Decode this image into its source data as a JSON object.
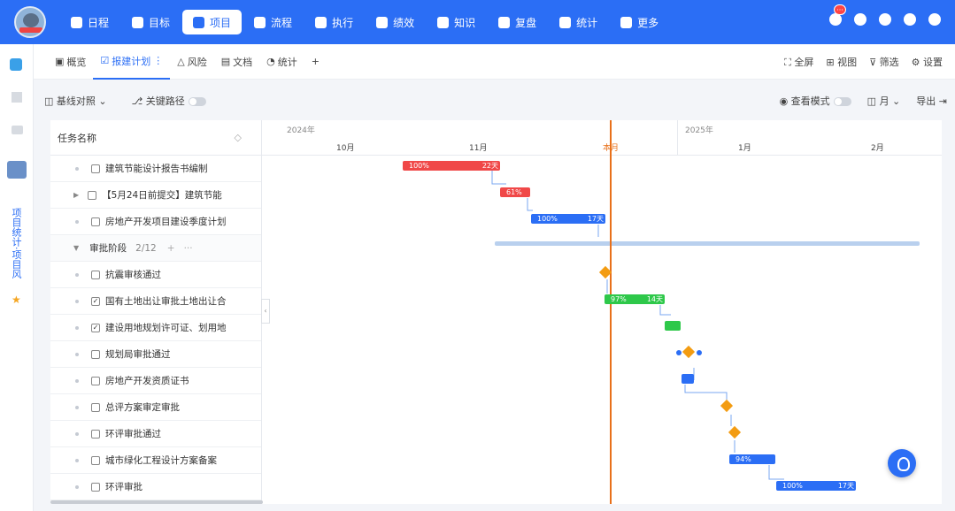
{
  "nav": {
    "items": [
      {
        "label": "日程",
        "icon": "calendar-icon"
      },
      {
        "label": "目标",
        "icon": "target-icon"
      },
      {
        "label": "项目",
        "icon": "cube-icon",
        "active": true
      },
      {
        "label": "流程",
        "icon": "flow-icon"
      },
      {
        "label": "执行",
        "icon": "list-icon"
      },
      {
        "label": "绩效",
        "icon": "chart-icon"
      },
      {
        "label": "知识",
        "icon": "book-icon"
      },
      {
        "label": "复盘",
        "icon": "shield-icon"
      },
      {
        "label": "统计",
        "icon": "pie-icon"
      },
      {
        "label": "更多",
        "icon": "grid-icon"
      }
    ],
    "notification_badge": "···"
  },
  "sidebar": {
    "vertical_label": "项目统计·项目风"
  },
  "tabs": {
    "items": [
      {
        "label": "概览"
      },
      {
        "label": "报建计划",
        "active": true
      },
      {
        "label": "风险"
      },
      {
        "label": "文档"
      },
      {
        "label": "统计"
      }
    ],
    "more": "⋮",
    "add": "+",
    "right": [
      "全屏",
      "视图",
      "筛选",
      "设置"
    ]
  },
  "toolbar": {
    "baseline": "基线对照",
    "critical_path": "关键路径",
    "view_mode": "查看模式",
    "scale": "月",
    "export": "导出"
  },
  "grid": {
    "header": "任务名称",
    "rows": [
      {
        "type": "task",
        "label": "建筑节能设计报告书编制",
        "checked": false
      },
      {
        "type": "task",
        "label": "【5月24日前提交】建筑节能",
        "checked": false,
        "expandable": true
      },
      {
        "type": "task",
        "label": "房地产开发项目建设季度计划",
        "checked": false
      },
      {
        "type": "group",
        "label": "审批阶段",
        "count": "2/12"
      },
      {
        "type": "task",
        "label": "抗震审核通过",
        "checked": false
      },
      {
        "type": "task",
        "label": "国有土地出让审批土地出让合",
        "checked": true
      },
      {
        "type": "task",
        "label": "建设用地规划许可证、划用地",
        "checked": true
      },
      {
        "type": "task",
        "label": "规划局审批通过",
        "checked": false
      },
      {
        "type": "task",
        "label": "房地产开发资质证书",
        "checked": false
      },
      {
        "type": "task",
        "label": "总评方案审定审批",
        "checked": false
      },
      {
        "type": "task",
        "label": "环评审批通过",
        "checked": false
      },
      {
        "type": "task",
        "label": "城市绿化工程设计方案备案",
        "checked": false
      },
      {
        "type": "task",
        "label": "环评审批",
        "checked": false
      }
    ]
  },
  "timeline": {
    "years": [
      "2024年",
      "2025年"
    ],
    "months": [
      "10月",
      "11月",
      "本月",
      "1月",
      "2月"
    ],
    "today_color": "#e8701a"
  },
  "bars": [
    {
      "row": 0,
      "pct": "100%",
      "dur": "22天",
      "color": "#f04848"
    },
    {
      "row": 1,
      "pct": "61%",
      "dur": "",
      "color": "#f04848"
    },
    {
      "row": 2,
      "pct": "100%",
      "dur": "17天",
      "color": "#2b6ef5"
    },
    {
      "row": 5,
      "pct": "97%",
      "dur": "14天",
      "color": "#2ec84a"
    },
    {
      "row": 6,
      "pct": "",
      "dur": "",
      "color": "#2ec84a"
    },
    {
      "row": 8,
      "pct": "",
      "dur": "",
      "color": "#2b6ef5"
    },
    {
      "row": 11,
      "pct": "94%",
      "dur": "",
      "color": "#2b6ef5"
    },
    {
      "row": 12,
      "pct": "100%",
      "dur": "17天",
      "color": "#2b6ef5"
    }
  ]
}
